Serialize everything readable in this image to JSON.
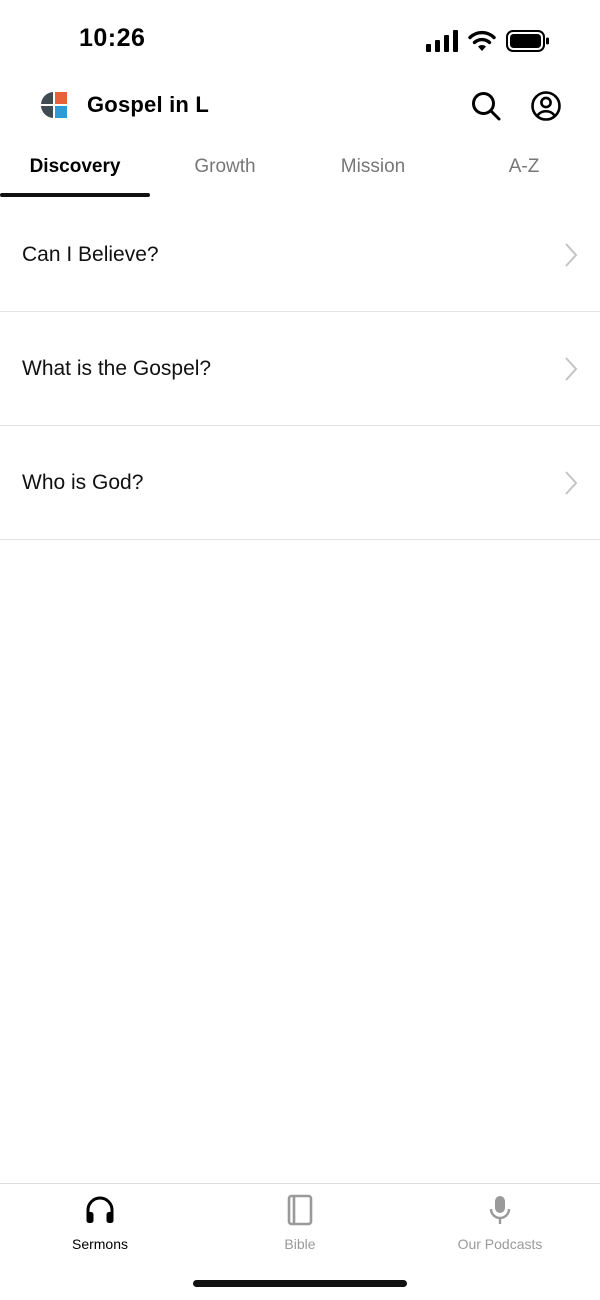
{
  "status_bar": {
    "time": "10:26"
  },
  "header": {
    "title": "Gospel in L"
  },
  "tabs": [
    {
      "label": "Discovery",
      "active": true
    },
    {
      "label": "Growth",
      "active": false
    },
    {
      "label": "Mission",
      "active": false
    },
    {
      "label": "A-Z",
      "active": false
    }
  ],
  "list": [
    {
      "label": "Can I Believe?"
    },
    {
      "label": "What is the Gospel?"
    },
    {
      "label": "Who is God?"
    }
  ],
  "bottom_nav": [
    {
      "label": "Sermons",
      "icon": "headphones-icon",
      "active": true
    },
    {
      "label": "Bible",
      "icon": "book-icon",
      "active": false
    },
    {
      "label": "Our Podcasts",
      "icon": "microphone-icon",
      "active": false
    }
  ],
  "colors": {
    "logo_orange": "#E8613A",
    "logo_blue": "#2E9BD6",
    "logo_dark": "#3F4A52"
  }
}
